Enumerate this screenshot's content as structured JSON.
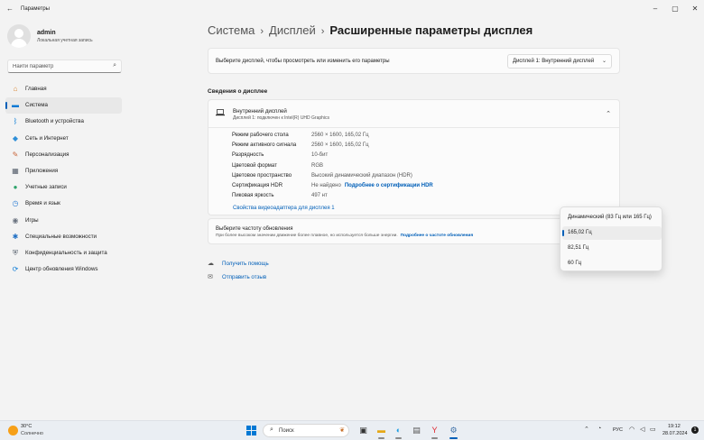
{
  "window": {
    "title": "Параметры",
    "back_icon": "←",
    "controls": [
      "–",
      "▢",
      "✕"
    ]
  },
  "user": {
    "name": "admin",
    "account_type": "Локальная учетная запись"
  },
  "search": {
    "placeholder": "Найти параметр",
    "icon": "⌕"
  },
  "nav": {
    "items": [
      {
        "label": "Главная",
        "icon": "home-icon",
        "glyph": "⌂",
        "color": "#d9822b"
      },
      {
        "label": "Система",
        "icon": "system-icon",
        "glyph": "▬",
        "color": "#0078d4",
        "active": true
      },
      {
        "label": "Bluetooth и устройства",
        "icon": "bluetooth-icon",
        "glyph": "ᛒ",
        "color": "#0078d4"
      },
      {
        "label": "Сеть и Интернет",
        "icon": "network-icon",
        "glyph": "◆",
        "color": "#2f8fd8"
      },
      {
        "label": "Персонализация",
        "icon": "brush-icon",
        "glyph": "✎",
        "color": "#c9663a"
      },
      {
        "label": "Приложения",
        "icon": "apps-icon",
        "glyph": "▦",
        "color": "#555e6b"
      },
      {
        "label": "Учетные записи",
        "icon": "accounts-icon",
        "glyph": "●",
        "color": "#2ea36b"
      },
      {
        "label": "Время и язык",
        "icon": "time-language-icon",
        "glyph": "◷",
        "color": "#2b7cd3"
      },
      {
        "label": "Игры",
        "icon": "gaming-icon",
        "glyph": "◉",
        "color": "#6b7380"
      },
      {
        "label": "Специальные возможности",
        "icon": "accessibility-icon",
        "glyph": "✱",
        "color": "#1f6fc4"
      },
      {
        "label": "Конфиденциальность и защита",
        "icon": "privacy-shield-icon",
        "glyph": "⛨",
        "color": "#5a6470"
      },
      {
        "label": "Центр обновления Windows",
        "icon": "windows-update-icon",
        "glyph": "⟳",
        "color": "#0a7ad6"
      }
    ]
  },
  "breadcrumb": {
    "parts": [
      "Система",
      "Дисплей"
    ],
    "separator": "›",
    "current": "Расширенные параметры дисплея"
  },
  "display_select": {
    "label": "Выберите дисплей, чтобы просмотреть или изменить его параметры",
    "value": "Дисплей 1: Внутренний дисплей",
    "chevron": "⌄"
  },
  "display_info": {
    "section_title": "Сведения о дисплее",
    "name": "Внутренний дисплей",
    "subtitle": "Дисплей 1: подключен к Intel(R) UHD Graphics",
    "collapse_glyph": "⌃",
    "properties": [
      {
        "key": "Режим рабочего стола",
        "value": "2560 × 1600, 165,02 Гц"
      },
      {
        "key": "Режим активного сигнала",
        "value": "2560 × 1600, 165,02 Гц"
      },
      {
        "key": "Разрядность",
        "value": "10-бит"
      },
      {
        "key": "Цветовой формат",
        "value": "RGB"
      },
      {
        "key": "Цветовое пространство",
        "value": "Высокий динамический диапазон (HDR)"
      },
      {
        "key": "Сертификация HDR",
        "value": "Не найдено",
        "link": "Подробнее о сертификации HDR"
      },
      {
        "key": "Пиковая яркость",
        "value": "497 нт"
      }
    ],
    "adapter_link": "Свойства видеоадаптера для дисплея 1"
  },
  "refresh_rate": {
    "title": "Выберите частоту обновления",
    "description": "При более высоком значении движение более плавное, но используется больше энергии.",
    "link": "Подробнее о частоте обновления",
    "options": [
      "Динамический (83 Гц или 165 Гц)",
      "165,02 Гц",
      "82,51 Гц",
      "60 Гц"
    ],
    "selected_index": 1
  },
  "help_links": [
    {
      "label": "Получить помощь",
      "icon": "help-icon",
      "glyph": "☁"
    },
    {
      "label": "Отправить отзыв",
      "icon": "feedback-icon",
      "glyph": "✉"
    }
  ],
  "taskbar": {
    "weather_temp": "30°C",
    "weather_desc": "Солнечно",
    "search_placeholder": "Поиск",
    "language": "РУС",
    "time": "19:12",
    "date": "28.07.2024",
    "notification_count": "1"
  },
  "colors": {
    "accent": "#005fb8",
    "background": "#f3f3f3",
    "card": "#fbfbfb"
  }
}
